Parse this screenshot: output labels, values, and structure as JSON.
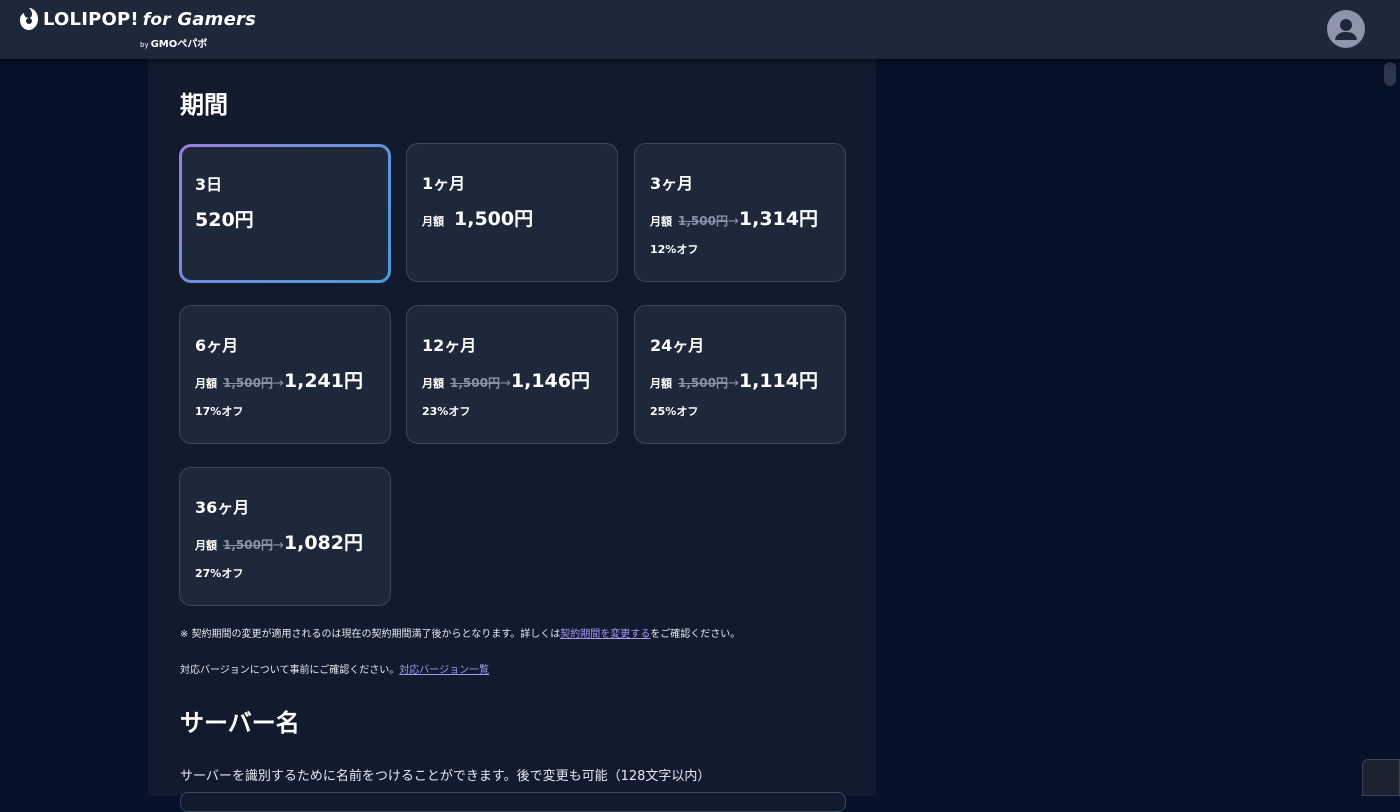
{
  "header": {
    "logo_main": "LOLIPOP!",
    "logo_for": "for",
    "logo_gamers": "Gamers",
    "logo_by": "by",
    "logo_company": "GMOペパボ",
    "avatar_icon": "user-avatar-icon"
  },
  "period": {
    "heading": "期間",
    "plans": [
      {
        "title": "3日",
        "monthly_label": "",
        "original": "",
        "arrow": "",
        "price": "520円",
        "discount": "",
        "selected": true
      },
      {
        "title": "1ヶ月",
        "monthly_label": "月額",
        "original": "",
        "arrow": "",
        "price": "1,500円",
        "discount": "",
        "selected": false
      },
      {
        "title": "3ヶ月",
        "monthly_label": "月額",
        "original": "1,500円",
        "arrow": "→",
        "price": "1,314円",
        "discount": "12%オフ",
        "selected": false
      },
      {
        "title": "6ヶ月",
        "monthly_label": "月額",
        "original": "1,500円",
        "arrow": "→",
        "price": "1,241円",
        "discount": "17%オフ",
        "selected": false
      },
      {
        "title": "12ヶ月",
        "monthly_label": "月額",
        "original": "1,500円",
        "arrow": "→",
        "price": "1,146円",
        "discount": "23%オフ",
        "selected": false
      },
      {
        "title": "24ヶ月",
        "monthly_label": "月額",
        "original": "1,500円",
        "arrow": "→",
        "price": "1,114円",
        "discount": "25%オフ",
        "selected": false
      },
      {
        "title": "36ヶ月",
        "monthly_label": "月額",
        "original": "1,500円",
        "arrow": "→",
        "price": "1,082円",
        "discount": "27%オフ",
        "selected": false
      }
    ],
    "note_prefix": "※ 契約期間の変更が適用されるのは現在の契約期間満了後からとなります。詳しくは",
    "note_link": "契約期間を変更する",
    "note_suffix": "をご確認ください。",
    "version_note": "対応バージョンについて事前にご確認ください。",
    "version_link": "対応バージョン一覧"
  },
  "server_name": {
    "heading": "サーバー名",
    "description": "サーバーを識別するために名前をつけることができます。後で変更も可能（128文字以内）"
  },
  "colors": {
    "background": "#06112a",
    "panel": "#111b2d",
    "card": "#1e283b",
    "header": "#1e283b",
    "link": "#a39bf5",
    "selected_gradient_start": "#9b7ee0",
    "selected_gradient_end": "#4a9bd6"
  }
}
